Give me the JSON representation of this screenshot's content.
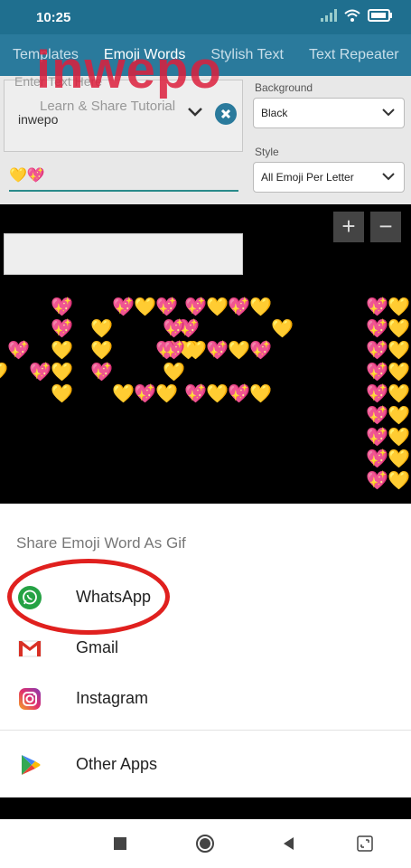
{
  "status_bar": {
    "time": "10:25"
  },
  "tabs": [
    {
      "label": "Templates"
    },
    {
      "label": "Emoji Words"
    },
    {
      "label": "Stylish Text"
    },
    {
      "label": "Text Repeater"
    }
  ],
  "watermark": {
    "brand": "inwepo",
    "tagline": "Learn & Share Tutorial"
  },
  "editor": {
    "text_placeholder": "Enter Text Here",
    "text_value": "inwepo",
    "emoji_value": "💛💖"
  },
  "background": {
    "label": "Background",
    "selected": "Black"
  },
  "style": {
    "label": "Style",
    "selected": "All Emoji Per Letter"
  },
  "zoom": {
    "in_label": "+",
    "out_label": "−"
  },
  "share_sheet": {
    "title": "Share Emoji Word As Gif",
    "options": [
      {
        "label": "WhatsApp",
        "icon": "whatsapp-icon"
      },
      {
        "label": "Gmail",
        "icon": "gmail-icon"
      },
      {
        "label": "Instagram",
        "icon": "instagram-icon"
      },
      {
        "label": "Other Apps",
        "icon": "play-store-icon"
      }
    ]
  },
  "colors": {
    "header": "#2a7a9c",
    "status_bar": "#1f6f8f",
    "highlight": "#e0201e",
    "whatsapp": "#25a244"
  }
}
